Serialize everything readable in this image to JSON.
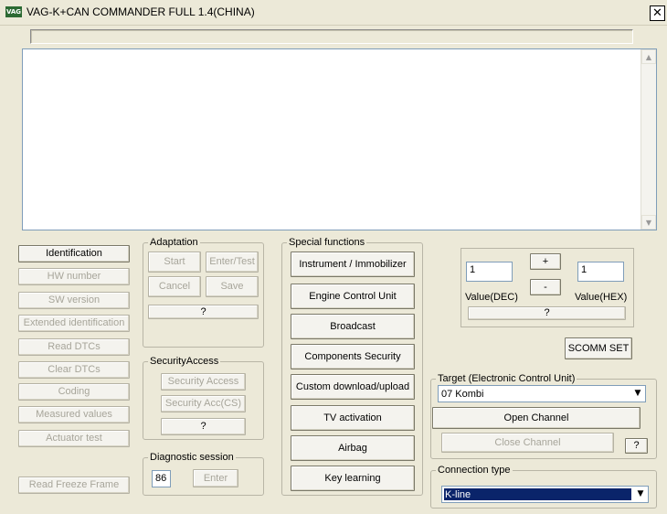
{
  "window": {
    "title": "VAG-K+CAN COMMANDER FULL 1.4(CHINA)",
    "icon_text": "VAG",
    "close_label": "✕"
  },
  "memo": {
    "scroll_up": "▲",
    "scroll_down": "▼"
  },
  "left_buttons": [
    {
      "label": "Identification",
      "enabled": true
    },
    {
      "label": "HW number",
      "enabled": false
    },
    {
      "label": "SW version",
      "enabled": false
    },
    {
      "label": "Extended identification",
      "enabled": false
    },
    {
      "label": "Read DTCs",
      "enabled": false
    },
    {
      "label": "Clear DTCs",
      "enabled": false
    },
    {
      "label": "Coding",
      "enabled": false
    },
    {
      "label": "Measured values",
      "enabled": false
    },
    {
      "label": "Actuator test",
      "enabled": false
    }
  ],
  "read_freeze_frame": "Read Freeze Frame",
  "adaptation": {
    "legend": "Adaptation",
    "start": "Start",
    "enter_test": "Enter/Test",
    "cancel": "Cancel",
    "save": "Save",
    "help": "?"
  },
  "security": {
    "legend": "SecurityAccess",
    "access": "Security Access",
    "access_cs": "Security Acc(CS)",
    "help": "?"
  },
  "diag": {
    "legend": "Diagnostic session",
    "value": "86",
    "enter": "Enter"
  },
  "special": {
    "legend": "Special functions",
    "buttons": [
      "Instrument / Immobilizer",
      "Engine Control Unit",
      "Broadcast",
      "Components Security",
      "Custom download/upload",
      "TV activation",
      "Airbag",
      "Key learning"
    ]
  },
  "value_panel": {
    "dec_value": "1",
    "hex_value": "1",
    "plus": "+",
    "minus": "-",
    "dec_label": "Value(DEC)",
    "hex_label": "Value(HEX)",
    "help": "?"
  },
  "scomm": "SCOMM SET",
  "target": {
    "legend": "Target (Electronic Control Unit)",
    "selected": "07 Kombi",
    "open": "Open Channel",
    "close": "Close Channel",
    "help": "?"
  },
  "connection": {
    "legend": "Connection type",
    "selected": "K-line"
  },
  "dropdown_arrow": "▼",
  "colors": {
    "selection": "#0a246a",
    "background": "#ece9d8"
  }
}
